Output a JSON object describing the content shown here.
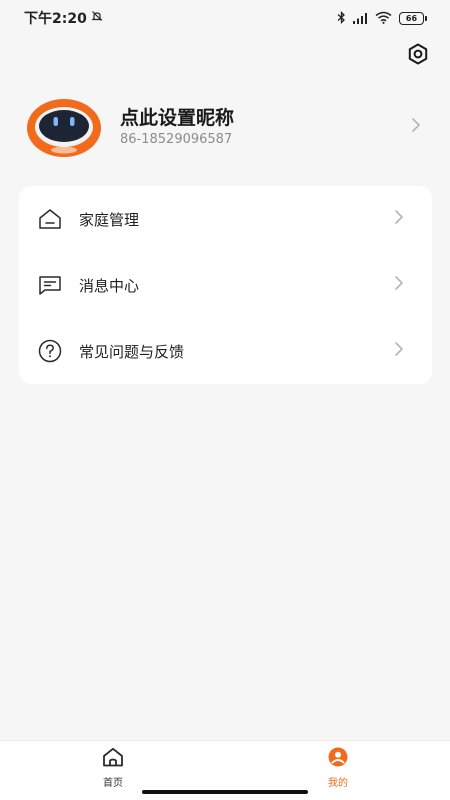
{
  "status_bar": {
    "time": "下午2:20",
    "battery": "66"
  },
  "profile": {
    "nickname": "点此设置昵称",
    "phone": "86-18529096587"
  },
  "menu": {
    "items": [
      {
        "label": "家庭管理",
        "icon": "home-icon"
      },
      {
        "label": "消息中心",
        "icon": "message-icon"
      },
      {
        "label": "常见问题与反馈",
        "icon": "help-icon"
      }
    ]
  },
  "tab_bar": {
    "tabs": [
      {
        "label": "首页",
        "icon": "home-tab-icon",
        "active": false
      },
      {
        "label": "我的",
        "icon": "profile-tab-icon",
        "active": true
      }
    ]
  },
  "colors": {
    "accent": "#f26b1d",
    "background": "#f6f6f6",
    "card": "#ffffff"
  }
}
